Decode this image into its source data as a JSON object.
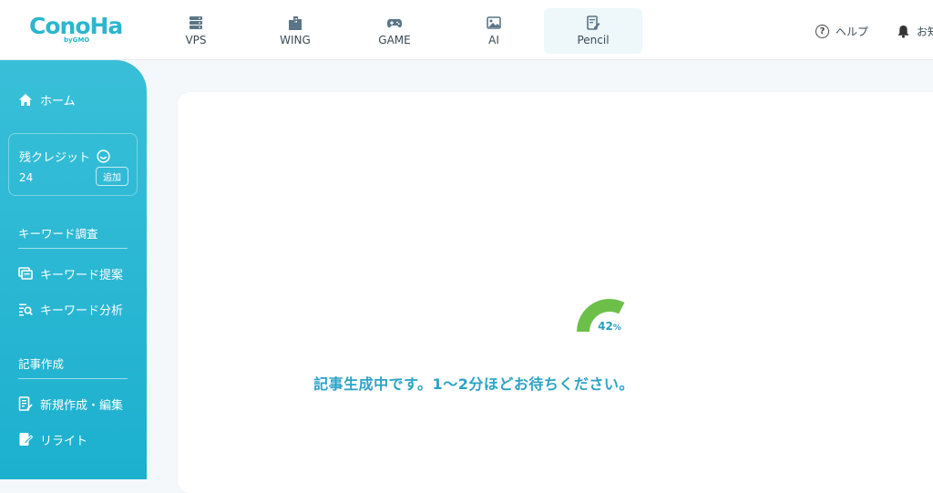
{
  "header": {
    "logo_text": "ConoHa",
    "logo_sub": "byGMO",
    "tabs": [
      {
        "label": "VPS",
        "icon": "server-icon"
      },
      {
        "label": "WING",
        "icon": "buildings-icon"
      },
      {
        "label": "GAME",
        "icon": "gamepad-icon"
      },
      {
        "label": "AI",
        "icon": "image-ai-icon"
      },
      {
        "label": "Pencil",
        "icon": "pencil-document-icon",
        "active": true
      }
    ],
    "help_label": "ヘルプ",
    "notify_label": "お知"
  },
  "sidebar": {
    "home_label": "ホーム",
    "credit": {
      "title": "残クレジット",
      "value": "24",
      "add_label": "追加"
    },
    "section_keyword": "キーワード調査",
    "keyword_suggest": "キーワード提案",
    "keyword_analysis": "キーワード分析",
    "section_article": "記事作成",
    "new_edit": "新規作成・編集",
    "rewrite": "リライト"
  },
  "main": {
    "progress_value": "42",
    "progress_unit": "%",
    "progress_fraction": 0.42,
    "status_message": "記事生成中です。1〜2分ほどお待ちください。"
  },
  "colors": {
    "accent": "#2bb6cf",
    "sidebar_top": "#39bfd8",
    "sidebar_bottom": "#1cb0cf",
    "progress_green": "#6cc04a",
    "status_text": "#2ba3c6"
  }
}
